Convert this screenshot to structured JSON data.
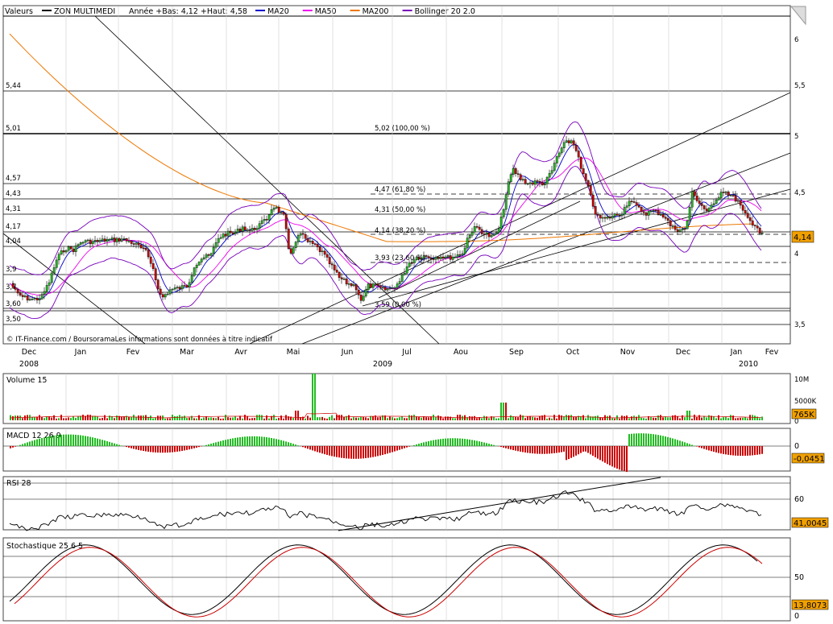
{
  "header": {
    "valeurs_label": "Valeurs",
    "stock_name": "ZON MULTIMEDI",
    "year_info": "Année +Bas: 4,12 +Haut: 4,58",
    "legend": [
      {
        "name": "MA20",
        "color": "#0000cc"
      },
      {
        "name": "MA50",
        "color": "#ee00ee"
      },
      {
        "name": "MA200",
        "color": "#ee7700"
      },
      {
        "name": "Bollinger 20 2.0",
        "color": "#7700bb"
      }
    ]
  },
  "source_text": "© IT-Finance.com / BoursoramaLes informations sont données à titre indicatif",
  "price_panel": {
    "left_labels": [
      "5,44",
      "5,01",
      "4,57",
      "4,43",
      "4,31",
      "4,17",
      "4,04",
      "3,9",
      "3,7",
      "3,60",
      "3,50"
    ],
    "right_ticks": [
      "6",
      "5,5",
      "5",
      "4,5",
      "4",
      "3,5"
    ],
    "fibo_labels": [
      "5,02 (100,00 %)",
      "4,47 (61,80 %)",
      "4,31 (50,00 %)",
      "4,14 (38,20 %)",
      "3,93 (23,60 %)",
      "3,59 (0,00 %)"
    ],
    "last_value": "4,14"
  },
  "x_axis": {
    "months": [
      "Dec",
      "Jan",
      "Fev",
      "Mar",
      "Avr",
      "Mai",
      "Jun",
      "Jul",
      "Aou",
      "Sep",
      "Oct",
      "Nov",
      "Dec",
      "Jan",
      "Fev"
    ],
    "years": [
      "2008",
      "2009",
      "2010"
    ]
  },
  "volume_panel": {
    "title": "Volume 15",
    "ticks": [
      "10M",
      "5000K",
      "0"
    ],
    "last_value": "765K"
  },
  "macd_panel": {
    "title": "MACD 12 26 9",
    "ticks": [
      "0"
    ],
    "last_value": "-0,0451"
  },
  "rsi_panel": {
    "title": "RSI 28",
    "ticks": [
      "60"
    ],
    "last_value": "41,0045"
  },
  "stoch_panel": {
    "title": "Stochastique 25 6 5",
    "ticks": [
      "50",
      "0"
    ],
    "last_value": "13,8073"
  },
  "chart_data": {
    "type": "candlestick",
    "title": "ZON MULTIMEDI",
    "x_range": [
      "2008-12",
      "2010-02"
    ],
    "ylim": [
      3.45,
      6.2
    ],
    "close_series": {
      "name": "ZON MULTIMEDI",
      "months": [
        "2008-12",
        "2009-01",
        "2009-02",
        "2009-03",
        "2009-04",
        "2009-05",
        "2009-06",
        "2009-07",
        "2009-08",
        "2009-09",
        "2009-10",
        "2009-11",
        "2009-12",
        "2010-01"
      ],
      "values": [
        3.62,
        4.0,
        4.1,
        3.7,
        4.15,
        4.3,
        3.85,
        3.75,
        4.05,
        4.5,
        4.95,
        4.3,
        4.28,
        4.14
      ]
    },
    "fibonacci": [
      {
        "level": "100,00 %",
        "value": 5.02
      },
      {
        "level": "61,80 %",
        "value": 4.47
      },
      {
        "level": "50,00 %",
        "value": 4.31
      },
      {
        "level": "38,20 %",
        "value": 4.14
      },
      {
        "level": "23,60 %",
        "value": 3.93
      },
      {
        "level": "0,00 %",
        "value": 3.59
      }
    ],
    "last_close": 4.14,
    "indicators": {
      "volume_last": "765K",
      "macd_last": -0.0451,
      "rsi_last": 41.0045,
      "stoch_last": 13.8073
    }
  }
}
